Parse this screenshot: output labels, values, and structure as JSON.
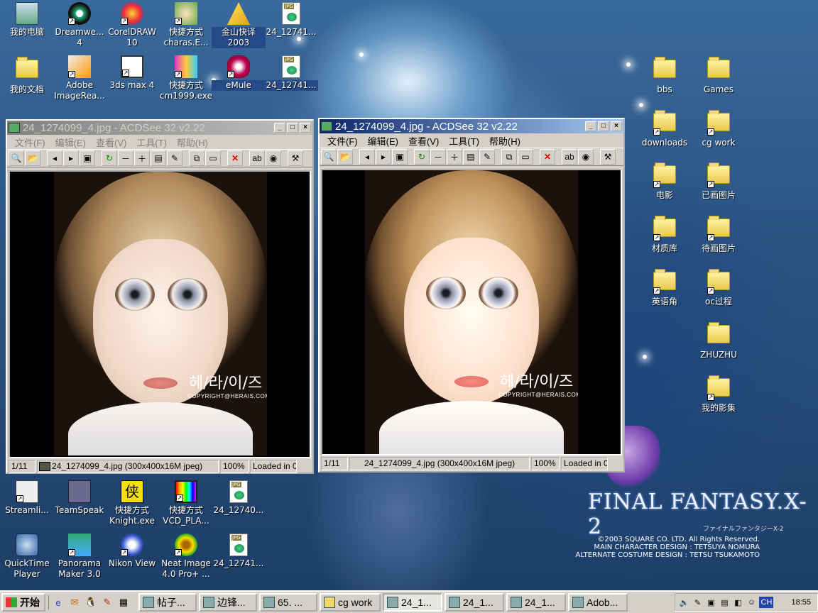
{
  "desktop": {
    "left_icons": [
      {
        "label": "我的电脑",
        "type": "computer"
      },
      {
        "label": "Dreamwe... 4",
        "type": "app"
      },
      {
        "label": "CorelDRAW 10",
        "type": "app"
      },
      {
        "label": "快捷方式 charas.E...",
        "type": "app"
      },
      {
        "label": "金山快译 2003",
        "type": "app"
      },
      {
        "label": "24_12741...",
        "type": "jpg"
      },
      {
        "label": "我的文档",
        "type": "docs"
      },
      {
        "label": "Adobe ImageRea...",
        "type": "app"
      },
      {
        "label": "3ds max 4",
        "type": "app"
      },
      {
        "label": "快捷方式 cm1999.exe",
        "type": "app"
      },
      {
        "label": "eMule",
        "type": "app"
      },
      {
        "label": "24_12741...",
        "type": "jpg"
      }
    ],
    "bottom_icons": [
      {
        "label": "Streamli...",
        "type": "app"
      },
      {
        "label": "TeamSpeak",
        "type": "app"
      },
      {
        "label": "快捷方式 Knight.exe",
        "type": "app"
      },
      {
        "label": "快捷方式 VCD_PLA...",
        "type": "app"
      },
      {
        "label": "24_12740...",
        "type": "jpg"
      },
      {
        "label": "QuickTime Player",
        "type": "app"
      },
      {
        "label": "Panorama Maker 3.0",
        "type": "app"
      },
      {
        "label": "Nikon View",
        "type": "app"
      },
      {
        "label": "Neat Image 4.0 Pro+ ...",
        "type": "app"
      },
      {
        "label": "24_12741...",
        "type": "jpg"
      }
    ],
    "right_icons": [
      {
        "label": "bbs"
      },
      {
        "label": "Games"
      },
      {
        "label": "downloads"
      },
      {
        "label": "cg work"
      },
      {
        "label": "电影"
      },
      {
        "label": "已画图片"
      },
      {
        "label": "材质库"
      },
      {
        "label": "待画图片"
      },
      {
        "label": "英语角"
      },
      {
        "label": "oc过程"
      },
      {
        "label": "ZHUZHU"
      },
      {
        "label": "我的影集"
      }
    ],
    "logo": "FINAL FANTASY.X-2",
    "logo_sub": "ファイナルファンタジーX-2",
    "credits": [
      "©2003 SQUARE CO. LTD. All Rights Reserved.",
      "MAIN CHARACTER DESIGN : TETSUYA NOMURA",
      "ALTERNATE COSTUME DESIGN : TETSU TSUKAMOTO"
    ]
  },
  "window_left": {
    "title": "24_1274099_4.jpg - ACDSee 32 v2.22",
    "menus": [
      "文件(F)",
      "编辑(E)",
      "查看(V)",
      "工具(T)",
      "帮助(H)"
    ],
    "status": {
      "index": "1/11",
      "file": "24_1274099_4.jpg (300x400x16M jpeg)",
      "zoom": "100%",
      "load": "Loaded in 0"
    },
    "watermark": "헤/라/이/즈",
    "copyright": "COPYRIGHT@HERAIS.COM"
  },
  "window_right": {
    "title": "24_1274099_4.jpg - ACDSee 32 v2.22",
    "menus": [
      "文件(F)",
      "编辑(E)",
      "查看(V)",
      "工具(T)",
      "帮助(H)"
    ],
    "status": {
      "index": "1/11",
      "file": "24_1274099_4.jpg (300x400x16M jpeg)",
      "zoom": "100%",
      "load": "Loaded in 0"
    },
    "watermark": "헤/라/이/즈",
    "copyright": "COPYRIGHT@HERAIS.COM"
  },
  "taskbar": {
    "start": "开始",
    "tasks": [
      {
        "label": "帖子..."
      },
      {
        "label": "边锋..."
      },
      {
        "label": "65. ..."
      },
      {
        "label": "cg work"
      },
      {
        "label": "24_1..."
      },
      {
        "label": "24_1..."
      },
      {
        "label": "24_1..."
      },
      {
        "label": "Adob..."
      }
    ],
    "tray_lang": "CH",
    "clock": "18:55"
  }
}
